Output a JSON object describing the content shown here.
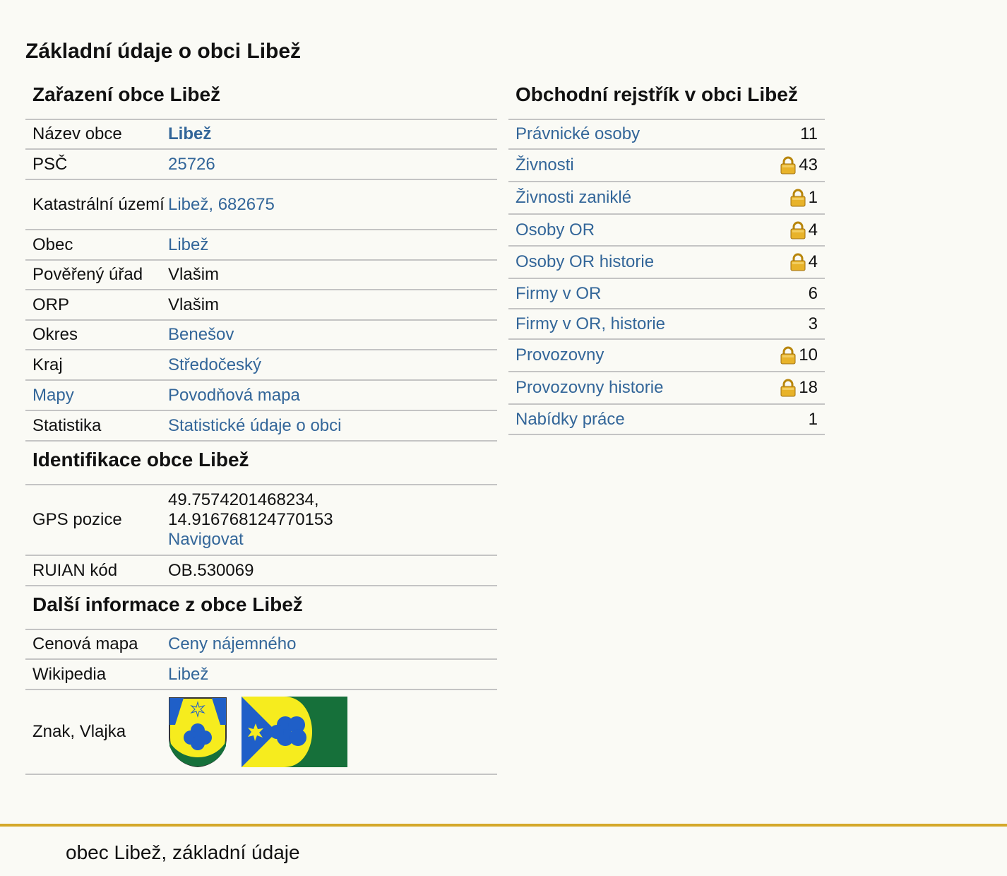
{
  "page_title": "Základní údaje o obci Libež",
  "zarazeni": {
    "title": "Zařazení obce Libež",
    "rows": [
      {
        "label": "Název obce",
        "value": "Libež"
      },
      {
        "label": "PSČ",
        "value": "25726"
      },
      {
        "label": "Katastrální území",
        "value": "Libež, 682675"
      },
      {
        "label": "Obec",
        "value": "Libež"
      },
      {
        "label": "Pověřený úřad",
        "value": "Vlašim"
      },
      {
        "label": "ORP",
        "value": "Vlašim"
      },
      {
        "label": "Okres",
        "value": "Benešov"
      },
      {
        "label": "Kraj",
        "value": "Středočeský"
      },
      {
        "label": "Mapy",
        "value": "Povodňová mapa"
      },
      {
        "label": "Statistika",
        "value": "Statistické údaje o obci"
      }
    ]
  },
  "identifikace": {
    "title": "Identifikace obce Libež",
    "gps_label": "GPS pozice",
    "gps_lat": "49.7574201468234,",
    "gps_lon": "14.916768124770153",
    "navigovat": "Navigovat",
    "ruian_label": "RUIAN kód",
    "ruian_value": "OB.530069"
  },
  "dalsi": {
    "title": "Další informace z obce Libež",
    "cenova_label": "Cenová mapa",
    "cenova_value": "Ceny nájemného",
    "wiki_label": "Wikipedia",
    "wiki_value": "Libež",
    "znak_label": "Znak, Vlajka"
  },
  "rejstrik": {
    "title": "Obchodní rejstřík v obci Libež",
    "rows": [
      {
        "label": "Právnické osoby",
        "value": "11",
        "locked": false
      },
      {
        "label": "Živnosti",
        "value": "43",
        "locked": true
      },
      {
        "label": "Živnosti zaniklé",
        "value": "1",
        "locked": true
      },
      {
        "label": "Osoby OR",
        "value": "4",
        "locked": true
      },
      {
        "label": "Osoby OR historie",
        "value": "4",
        "locked": true
      },
      {
        "label": "Firmy v OR",
        "value": "6",
        "locked": false
      },
      {
        "label": "Firmy v OR, historie",
        "value": "3",
        "locked": false
      },
      {
        "label": "Provozovny",
        "value": "10",
        "locked": true
      },
      {
        "label": "Provozovny historie",
        "value": "18",
        "locked": true
      },
      {
        "label": "Nabídky práce",
        "value": "1",
        "locked": false
      }
    ]
  },
  "footer": {
    "text": "obec Libež, základní údaje"
  },
  "colors": {
    "link": "#336699",
    "accent": "#d4a82a",
    "background": "#fafaf5",
    "emblem_blue": "#1f5fc8",
    "emblem_yellow": "#f6ec1e",
    "emblem_green": "#16703a"
  }
}
